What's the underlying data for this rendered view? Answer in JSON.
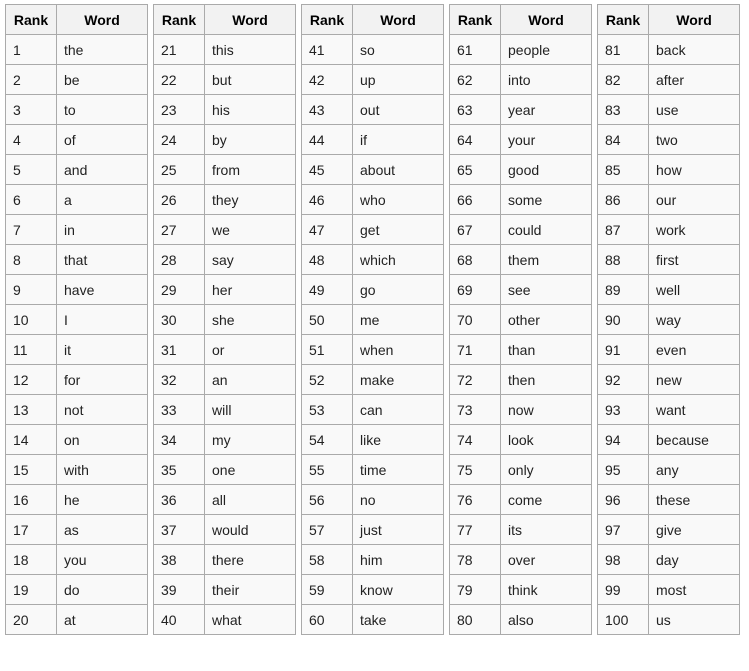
{
  "headers": {
    "rank": "Rank",
    "word": "Word"
  },
  "tables": [
    {
      "rows": [
        {
          "rank": "1",
          "word": "the"
        },
        {
          "rank": "2",
          "word": "be"
        },
        {
          "rank": "3",
          "word": "to"
        },
        {
          "rank": "4",
          "word": "of"
        },
        {
          "rank": "5",
          "word": "and"
        },
        {
          "rank": "6",
          "word": "a"
        },
        {
          "rank": "7",
          "word": "in"
        },
        {
          "rank": "8",
          "word": "that"
        },
        {
          "rank": "9",
          "word": "have"
        },
        {
          "rank": "10",
          "word": "I"
        },
        {
          "rank": "11",
          "word": "it"
        },
        {
          "rank": "12",
          "word": "for"
        },
        {
          "rank": "13",
          "word": "not"
        },
        {
          "rank": "14",
          "word": "on"
        },
        {
          "rank": "15",
          "word": "with"
        },
        {
          "rank": "16",
          "word": "he"
        },
        {
          "rank": "17",
          "word": "as"
        },
        {
          "rank": "18",
          "word": "you"
        },
        {
          "rank": "19",
          "word": "do"
        },
        {
          "rank": "20",
          "word": "at"
        }
      ]
    },
    {
      "rows": [
        {
          "rank": "21",
          "word": "this"
        },
        {
          "rank": "22",
          "word": "but"
        },
        {
          "rank": "23",
          "word": "his"
        },
        {
          "rank": "24",
          "word": "by"
        },
        {
          "rank": "25",
          "word": "from"
        },
        {
          "rank": "26",
          "word": "they"
        },
        {
          "rank": "27",
          "word": "we"
        },
        {
          "rank": "28",
          "word": "say"
        },
        {
          "rank": "29",
          "word": "her"
        },
        {
          "rank": "30",
          "word": "she"
        },
        {
          "rank": "31",
          "word": "or"
        },
        {
          "rank": "32",
          "word": "an"
        },
        {
          "rank": "33",
          "word": "will"
        },
        {
          "rank": "34",
          "word": "my"
        },
        {
          "rank": "35",
          "word": "one"
        },
        {
          "rank": "36",
          "word": "all"
        },
        {
          "rank": "37",
          "word": "would"
        },
        {
          "rank": "38",
          "word": "there"
        },
        {
          "rank": "39",
          "word": "their"
        },
        {
          "rank": "40",
          "word": "what"
        }
      ]
    },
    {
      "rows": [
        {
          "rank": "41",
          "word": "so"
        },
        {
          "rank": "42",
          "word": "up"
        },
        {
          "rank": "43",
          "word": "out"
        },
        {
          "rank": "44",
          "word": "if"
        },
        {
          "rank": "45",
          "word": "about"
        },
        {
          "rank": "46",
          "word": "who"
        },
        {
          "rank": "47",
          "word": "get"
        },
        {
          "rank": "48",
          "word": "which"
        },
        {
          "rank": "49",
          "word": "go"
        },
        {
          "rank": "50",
          "word": "me"
        },
        {
          "rank": "51",
          "word": "when"
        },
        {
          "rank": "52",
          "word": "make"
        },
        {
          "rank": "53",
          "word": "can"
        },
        {
          "rank": "54",
          "word": "like"
        },
        {
          "rank": "55",
          "word": "time"
        },
        {
          "rank": "56",
          "word": "no"
        },
        {
          "rank": "57",
          "word": "just"
        },
        {
          "rank": "58",
          "word": "him"
        },
        {
          "rank": "59",
          "word": "know"
        },
        {
          "rank": "60",
          "word": "take"
        }
      ]
    },
    {
      "rows": [
        {
          "rank": "61",
          "word": "people"
        },
        {
          "rank": "62",
          "word": "into"
        },
        {
          "rank": "63",
          "word": "year"
        },
        {
          "rank": "64",
          "word": "your"
        },
        {
          "rank": "65",
          "word": "good"
        },
        {
          "rank": "66",
          "word": "some"
        },
        {
          "rank": "67",
          "word": "could"
        },
        {
          "rank": "68",
          "word": "them"
        },
        {
          "rank": "69",
          "word": "see"
        },
        {
          "rank": "70",
          "word": "other"
        },
        {
          "rank": "71",
          "word": "than"
        },
        {
          "rank": "72",
          "word": "then"
        },
        {
          "rank": "73",
          "word": "now"
        },
        {
          "rank": "74",
          "word": "look"
        },
        {
          "rank": "75",
          "word": "only"
        },
        {
          "rank": "76",
          "word": "come"
        },
        {
          "rank": "77",
          "word": "its"
        },
        {
          "rank": "78",
          "word": "over"
        },
        {
          "rank": "79",
          "word": "think"
        },
        {
          "rank": "80",
          "word": "also"
        }
      ]
    },
    {
      "rows": [
        {
          "rank": "81",
          "word": "back"
        },
        {
          "rank": "82",
          "word": "after"
        },
        {
          "rank": "83",
          "word": "use"
        },
        {
          "rank": "84",
          "word": "two"
        },
        {
          "rank": "85",
          "word": "how"
        },
        {
          "rank": "86",
          "word": "our"
        },
        {
          "rank": "87",
          "word": "work"
        },
        {
          "rank": "88",
          "word": "first"
        },
        {
          "rank": "89",
          "word": "well"
        },
        {
          "rank": "90",
          "word": "way"
        },
        {
          "rank": "91",
          "word": "even"
        },
        {
          "rank": "92",
          "word": "new"
        },
        {
          "rank": "93",
          "word": "want"
        },
        {
          "rank": "94",
          "word": "because"
        },
        {
          "rank": "95",
          "word": "any"
        },
        {
          "rank": "96",
          "word": "these"
        },
        {
          "rank": "97",
          "word": "give"
        },
        {
          "rank": "98",
          "word": "day"
        },
        {
          "rank": "99",
          "word": "most"
        },
        {
          "rank": "100",
          "word": "us"
        }
      ]
    }
  ]
}
